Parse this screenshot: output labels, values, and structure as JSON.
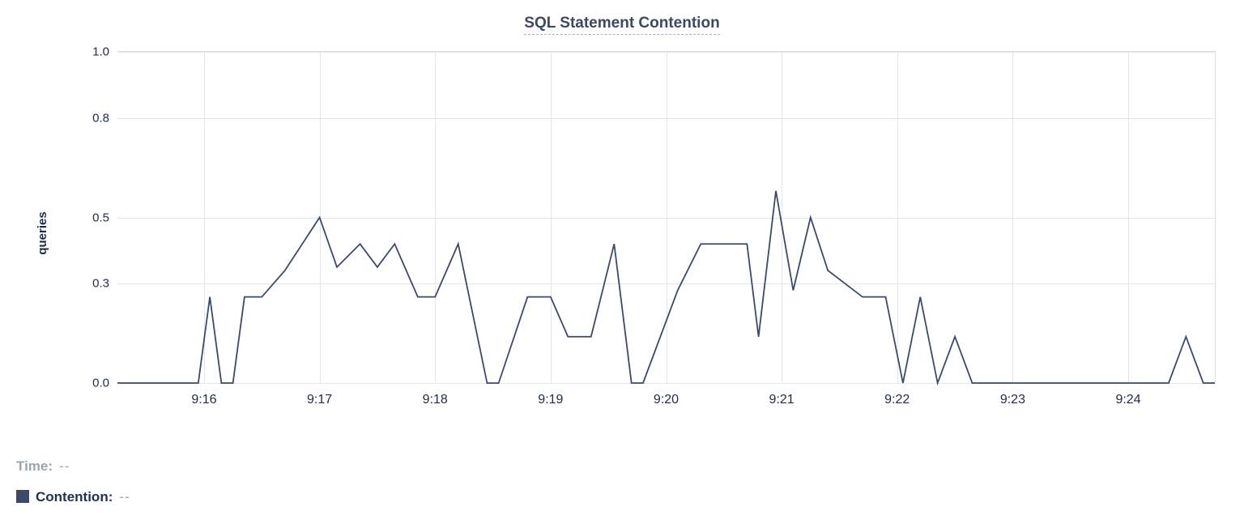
{
  "chart_data": {
    "type": "line",
    "title": "SQL Statement Contention",
    "ylabel": "queries",
    "xlabel": "",
    "ylim": [
      0,
      1.0
    ],
    "yticks": [
      "0.0",
      "0.3",
      "0.5",
      "0.8",
      "1.0"
    ],
    "x_start_minute": 915.25,
    "x_end_minute": 924.75,
    "x_tick_minutes": [
      916,
      917,
      918,
      919,
      920,
      921,
      922,
      923,
      924
    ],
    "x_tick_labels": [
      "9:16",
      "9:17",
      "9:18",
      "9:19",
      "9:20",
      "9:21",
      "9:22",
      "9:23",
      "9:24"
    ],
    "series": [
      {
        "name": "Contention",
        "color": "#3b4a68",
        "points": [
          [
            915.25,
            0.0
          ],
          [
            915.95,
            0.0
          ],
          [
            916.05,
            0.26
          ],
          [
            916.15,
            0.0
          ],
          [
            916.25,
            0.0
          ],
          [
            916.35,
            0.26
          ],
          [
            916.5,
            0.26
          ],
          [
            916.7,
            0.34
          ],
          [
            917.0,
            0.5
          ],
          [
            917.15,
            0.35
          ],
          [
            917.35,
            0.42
          ],
          [
            917.5,
            0.35
          ],
          [
            917.65,
            0.42
          ],
          [
            917.85,
            0.26
          ],
          [
            918.0,
            0.26
          ],
          [
            918.2,
            0.42
          ],
          [
            918.45,
            0.0
          ],
          [
            918.55,
            0.0
          ],
          [
            918.8,
            0.26
          ],
          [
            919.0,
            0.26
          ],
          [
            919.15,
            0.14
          ],
          [
            919.35,
            0.14
          ],
          [
            919.55,
            0.42
          ],
          [
            919.7,
            0.0
          ],
          [
            919.8,
            0.0
          ],
          [
            920.1,
            0.28
          ],
          [
            920.3,
            0.42
          ],
          [
            920.7,
            0.42
          ],
          [
            920.8,
            0.14
          ],
          [
            920.95,
            0.58
          ],
          [
            921.1,
            0.28
          ],
          [
            921.25,
            0.5
          ],
          [
            921.4,
            0.34
          ],
          [
            921.7,
            0.26
          ],
          [
            921.9,
            0.26
          ],
          [
            922.05,
            0.0
          ],
          [
            922.2,
            0.26
          ],
          [
            922.35,
            0.0
          ],
          [
            922.5,
            0.14
          ],
          [
            922.65,
            0.0
          ],
          [
            924.35,
            0.0
          ],
          [
            924.5,
            0.14
          ],
          [
            924.65,
            0.0
          ],
          [
            924.75,
            0.0
          ]
        ]
      }
    ]
  },
  "legend": {
    "time_label": "Time:",
    "time_value": "--",
    "series_label": "Contention:",
    "series_value": "--"
  }
}
